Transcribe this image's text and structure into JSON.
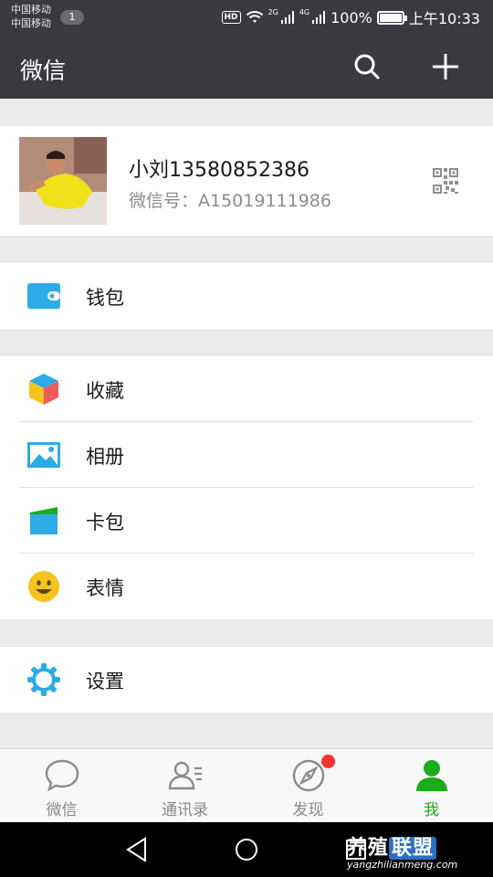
{
  "status_bar": {
    "carrier_1": "中国移动",
    "carrier_2": "中国移动",
    "notification_count": "1",
    "hd": "HD",
    "net_2g": "2G",
    "net_4g": "4G",
    "battery": "100%",
    "time": "上午10:33"
  },
  "header": {
    "title": "微信",
    "search_icon": "search-icon",
    "add_icon": "plus-icon"
  },
  "profile": {
    "nickname": "小刘13580852386",
    "wechat_id": "微信号：A15019111986",
    "qr_icon": "qr-code-icon"
  },
  "menu": {
    "wallet": {
      "label": "钱包",
      "icon": "wallet-icon"
    },
    "favorites": {
      "label": "收藏",
      "icon": "cube-icon"
    },
    "album": {
      "label": "相册",
      "icon": "photo-icon"
    },
    "cards": {
      "label": "卡包",
      "icon": "card-icon"
    },
    "stickers": {
      "label": "表情",
      "icon": "smiley-icon"
    },
    "settings": {
      "label": "设置",
      "icon": "gear-icon"
    }
  },
  "tabbar": {
    "tabs": [
      {
        "label": "微信",
        "icon": "chat-bubble-icon",
        "active": false
      },
      {
        "label": "通讯录",
        "icon": "contacts-icon",
        "active": false
      },
      {
        "label": "发现",
        "icon": "compass-icon",
        "active": false,
        "badge": "red-dot"
      },
      {
        "label": "我",
        "icon": "person-icon",
        "active": true
      }
    ]
  },
  "watermark": {
    "main_text_1": "养殖",
    "main_text_2": "联盟",
    "url": "yangzhilianmeng.com"
  },
  "colors": {
    "header_bg": "#393a3f",
    "accent_green": "#1aad19",
    "wallet_blue": "#2cabe6",
    "badge_red": "#f43530",
    "sticker_yellow": "#f6c31c"
  }
}
